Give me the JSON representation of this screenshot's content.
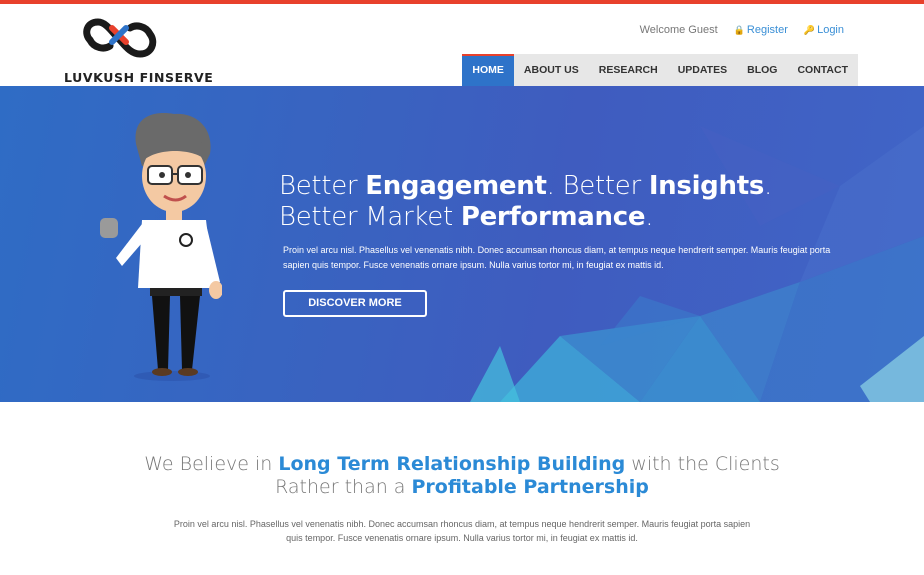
{
  "brand": {
    "name": "LUVKUSH FINSERVE",
    "accent": "#e8412c",
    "primary": "#2e73c9"
  },
  "userbar": {
    "welcome": "Welcome Guest",
    "register": "Register",
    "login": "Login"
  },
  "nav": {
    "items": [
      "HOME",
      "ABOUT US",
      "RESEARCH",
      "UPDATES",
      "BLOG",
      "CONTACT"
    ],
    "active": "HOME"
  },
  "hero": {
    "line1_a": "Better ",
    "line1_b": "Engagement",
    "line1_c": ". Better ",
    "line1_d": "Insights",
    "line1_e": ".",
    "line2_a": "Better Market ",
    "line2_b": "Performance",
    "line2_c": ".",
    "text": "Proin vel arcu nisl. Phasellus vel venenatis nibh. Donec accumsan rhoncus diam, at tempus neque hendrerit semper. Mauris feugiat porta sapien quis tempor. Fusce venenatis ornare ipsum. Nulla varius tortor mi, in feugiat ex mattis id.",
    "button": "DISCOVER MORE"
  },
  "belief": {
    "l1_a": "We Believe in ",
    "l1_b": "Long Term Relationship Building",
    "l1_c": " with the Clients",
    "l2_a": "Rather than a ",
    "l2_b": "Profitable Partnership",
    "text": "Proin vel arcu nisl. Phasellus vel venenatis nibh. Donec accumsan rhoncus diam, at tempus neque hendrerit semper. Mauris feugiat porta sapien quis tempor. Fusce venenatis ornare ipsum. Nulla varius tortor mi, in feugiat ex mattis id."
  }
}
